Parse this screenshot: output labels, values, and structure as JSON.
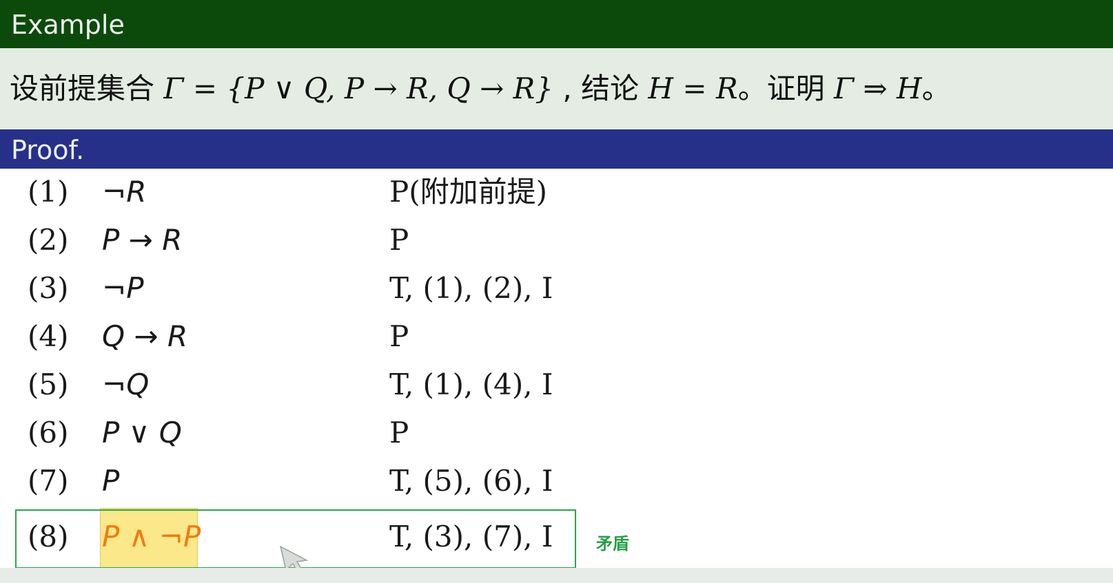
{
  "example": {
    "title": "Example",
    "statement_prefix": "设前提集合 ",
    "statement_gamma": "Γ = {P ∨ Q, P → R, Q → R}",
    "statement_mid": " , 结论 ",
    "statement_h": "H = R",
    "statement_tail": "。证明 ",
    "statement_goal": "Γ ⇒ H",
    "statement_end": "。"
  },
  "proof": {
    "title": "Proof.",
    "steps": [
      {
        "num": "(1)",
        "formula": "¬R",
        "rule": "P(附加前提)"
      },
      {
        "num": "(2)",
        "formula": "P → R",
        "rule": "P"
      },
      {
        "num": "(3)",
        "formula": "¬P",
        "rule": "T, (1), (2), I"
      },
      {
        "num": "(4)",
        "formula": "Q → R",
        "rule": "P"
      },
      {
        "num": "(5)",
        "formula": "¬Q",
        "rule": "T, (1), (4), I"
      },
      {
        "num": "(6)",
        "formula": "P ∨ Q",
        "rule": "P"
      },
      {
        "num": "(7)",
        "formula": "P",
        "rule": "T, (5), (6), I"
      },
      {
        "num": "(8)",
        "formula": "P ∧ ¬P",
        "rule": "T, (3), (7), I"
      }
    ],
    "annotation": "矛盾"
  },
  "colors": {
    "example_header": "#0c4a0c",
    "proof_header": "#263088",
    "highlight_text": "#f07c10",
    "highlight_bg": "#fbe88a",
    "annotation_green": "#22a042"
  }
}
